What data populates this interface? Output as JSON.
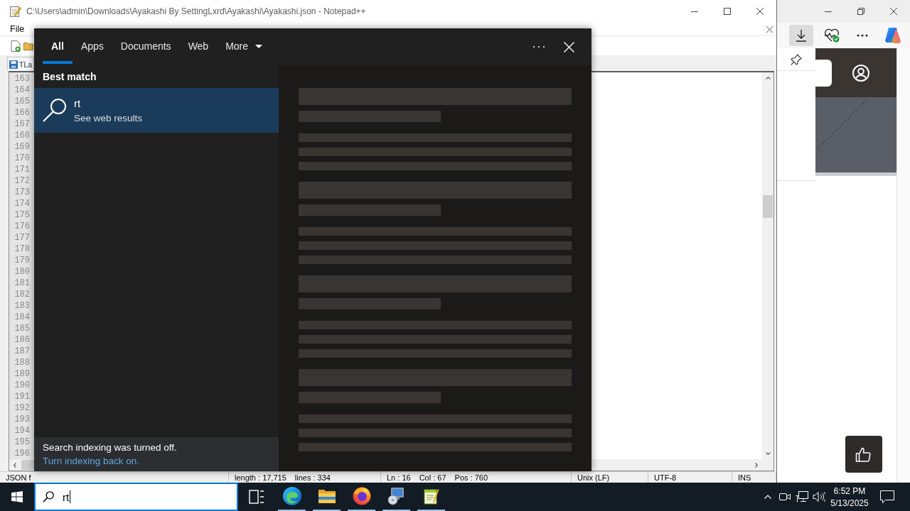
{
  "notepad": {
    "title": "C:\\Users\\admin\\Downloads\\Ayakashi By SettingLxrd\\Ayakashi\\Ayakashi.json - Notepad++",
    "menu": [
      "File"
    ],
    "tabs": [
      {
        "label": "TLa",
        "selected": true
      }
    ],
    "line_numbers": [
      "163",
      "164",
      "165",
      "166",
      "167",
      "168",
      "169",
      "170",
      "171",
      "172",
      "173",
      "174",
      "175",
      "176",
      "177",
      "178",
      "179",
      "180",
      "181",
      "182",
      "183",
      "184",
      "185",
      "186",
      "187",
      "188",
      "189",
      "190",
      "191",
      "192",
      "193",
      "194",
      "195",
      "196"
    ],
    "status_bar": [
      {
        "parts": [
          "JSON f"
        ]
      },
      {
        "parts": [
          "length : 17,715",
          "lines : 334"
        ]
      },
      {
        "parts": [
          "Ln : 16",
          "Col : 67",
          "Pos : 760"
        ]
      },
      {
        "parts": [
          "Unix (LF)"
        ]
      },
      {
        "parts": [
          "UTF-8"
        ]
      },
      {
        "parts": [
          "INS"
        ]
      }
    ]
  },
  "search_panel": {
    "tabs": [
      {
        "label": "All",
        "selected": true,
        "kind": "tab"
      },
      {
        "label": "Apps",
        "selected": false,
        "kind": "tab"
      },
      {
        "label": "Documents",
        "selected": false,
        "kind": "tab"
      },
      {
        "label": "Web",
        "selected": false,
        "kind": "tab"
      },
      {
        "label": "More",
        "selected": false,
        "kind": "dropdown"
      }
    ],
    "section_heading": "Best match",
    "best_match": {
      "title": "rt",
      "subtitle": "See web results",
      "selected": true
    },
    "results_preview": {
      "loading": true
    },
    "notice": {
      "text": "Search indexing was turned off.",
      "link": "Turn indexing back on."
    }
  },
  "taskbar": {
    "search": {
      "value": "rt"
    },
    "apps": [
      {
        "kind": "edge",
        "running": true
      },
      {
        "kind": "explorer",
        "running": true
      },
      {
        "kind": "firefox",
        "running": true
      },
      {
        "kind": "installer",
        "running": true
      },
      {
        "kind": "notepad",
        "running": true
      }
    ],
    "clock": {
      "time": "6:52 PM",
      "date": "5/13/2025"
    }
  },
  "browser": {
    "toolbar": [
      {
        "kind": "download",
        "active": true
      },
      {
        "kind": "health",
        "active": false
      },
      {
        "kind": "more",
        "active": false
      },
      {
        "kind": "assistant",
        "active": false
      }
    ]
  }
}
